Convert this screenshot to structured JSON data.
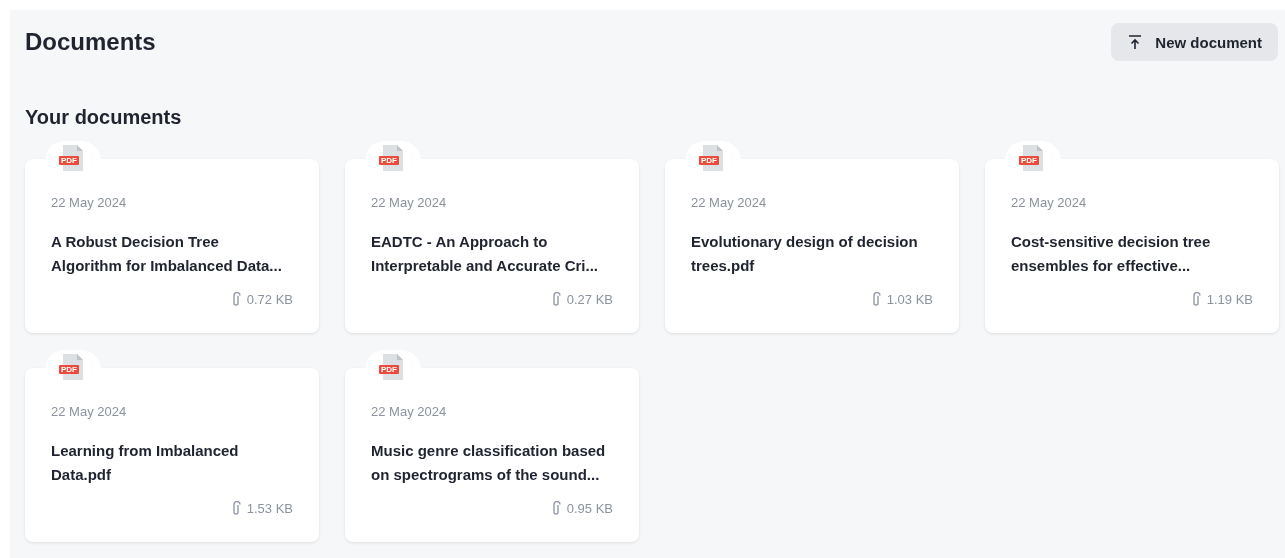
{
  "header": {
    "title": "Documents",
    "button": "New document"
  },
  "section": {
    "title": "Your documents"
  },
  "documents": [
    {
      "type": "PDF",
      "date": "22 May 2024",
      "title": "A Robust Decision Tree Algorithm for Imbalanced Data...",
      "size": "0.72 KB"
    },
    {
      "type": "PDF",
      "date": "22 May 2024",
      "title": "EADTC - An Approach to Interpretable and Accurate Cri...",
      "size": "0.27 KB"
    },
    {
      "type": "PDF",
      "date": "22 May 2024",
      "title": "Evolutionary design of decision trees.pdf",
      "size": "1.03 KB"
    },
    {
      "type": "PDF",
      "date": "22 May 2024",
      "title": "Cost-sensitive decision tree ensembles for effective...",
      "size": "1.19 KB"
    },
    {
      "type": "PDF",
      "date": "22 May 2024",
      "title": "Learning from Imbalanced Data.pdf",
      "size": "1.53 KB"
    },
    {
      "type": "PDF",
      "date": "22 May 2024",
      "title": "Music genre classification based on spectrograms of the sound...",
      "size": "0.95 KB"
    }
  ]
}
